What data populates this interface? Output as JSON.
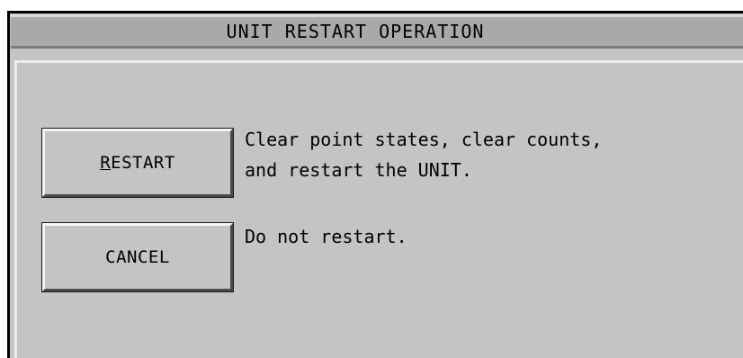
{
  "dialog": {
    "title": "UNIT RESTART OPERATION"
  },
  "buttons": {
    "restart": {
      "mnemonic": "R",
      "rest": "ESTART"
    },
    "cancel": {
      "label": "CANCEL"
    }
  },
  "descriptions": {
    "restart_line1": "Clear point states, clear counts,",
    "restart_line2": "and restart the UNIT.",
    "cancel": "Do not restart."
  }
}
